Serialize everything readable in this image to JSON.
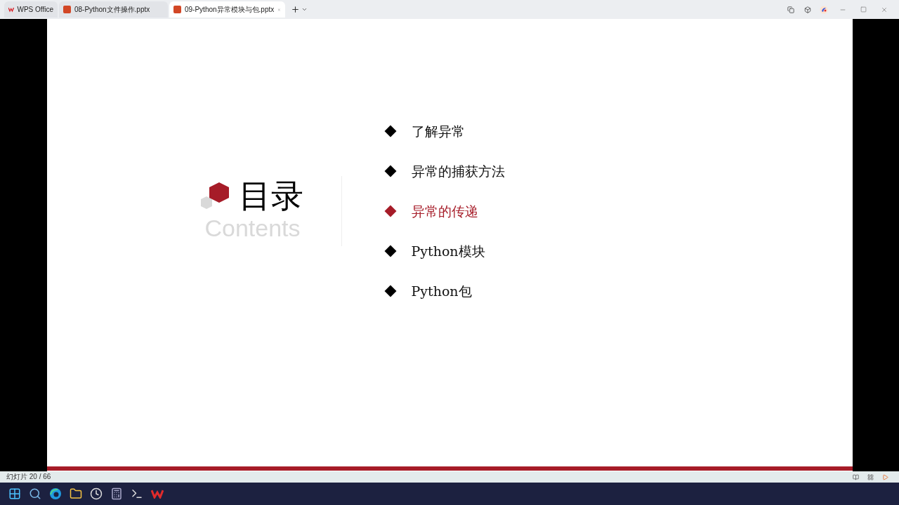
{
  "tabs": [
    {
      "label": "WPS Office",
      "kind": "home",
      "selected": false
    },
    {
      "label": "08-Python文件操作.pptx",
      "kind": "doc",
      "selected": false
    },
    {
      "label": "09-Python异常模块与包.pptx",
      "kind": "doc",
      "selected": true
    }
  ],
  "slide": {
    "title": "目录",
    "subtitle": "Contents",
    "items": [
      {
        "label": "了解异常",
        "selected": false
      },
      {
        "label": "异常的捕获方法",
        "selected": false
      },
      {
        "label": "异常的传递",
        "selected": true
      },
      {
        "label": "Python模块",
        "selected": false
      },
      {
        "label": "Python包",
        "selected": false
      }
    ]
  },
  "status_bar": {
    "slide_counter": "幻灯片 20 / 66"
  }
}
